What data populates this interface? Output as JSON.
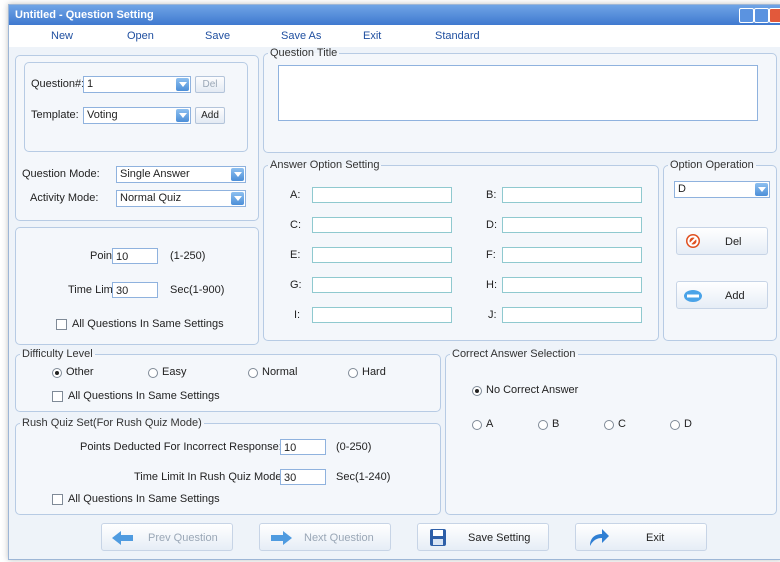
{
  "window": {
    "title": "Untitled - Question Setting"
  },
  "menu": [
    "New",
    "Open",
    "Save",
    "Save As",
    "Exit",
    "Standard"
  ],
  "question": {
    "number_label": "Question#:",
    "number_value": "1",
    "del_label": "Del",
    "template_label": "Template:",
    "template_value": "Voting",
    "add_label": "Add"
  },
  "modes": {
    "question_mode_label": "Question Mode:",
    "question_mode_value": "Single Answer",
    "activity_mode_label": "Activity Mode:",
    "activity_mode_value": "Normal Quiz"
  },
  "points": {
    "point_label": "Point:",
    "point_value": "10",
    "point_range": "(1-250)",
    "time_label": "Time Limit:",
    "time_value": "30",
    "time_range": "Sec(1-900)",
    "same_settings": "All Questions In Same Settings"
  },
  "question_title": {
    "legend": "Question Title",
    "value": ""
  },
  "answer_options": {
    "legend": "Answer Option Setting",
    "options": [
      {
        "label": "A:",
        "value": ""
      },
      {
        "label": "B:",
        "value": ""
      },
      {
        "label": "C:",
        "value": ""
      },
      {
        "label": "D:",
        "value": ""
      },
      {
        "label": "E:",
        "value": ""
      },
      {
        "label": "F:",
        "value": ""
      },
      {
        "label": "G:",
        "value": ""
      },
      {
        "label": "H:",
        "value": ""
      },
      {
        "label": "I:",
        "value": ""
      },
      {
        "label": "J:",
        "value": ""
      }
    ]
  },
  "option_operation": {
    "legend": "Option Operation",
    "selected": "D",
    "del_label": "Del",
    "add_label": "Add"
  },
  "difficulty": {
    "legend": "Difficulty Level",
    "options": [
      "Other",
      "Easy",
      "Normal",
      "Hard"
    ],
    "selected": "Other",
    "same_settings": "All Questions In Same Settings"
  },
  "rush_quiz": {
    "legend": "Rush Quiz Set(For Rush Quiz Mode)",
    "deduct_label": "Points Deducted For Incorrect Response:",
    "deduct_value": "10",
    "deduct_range": "(0-250)",
    "time_label": "Time Limit In Rush Quiz Mode:",
    "time_value": "30",
    "time_range": "Sec(1-240)",
    "same_settings": "All Questions In Same Settings"
  },
  "correct_answer": {
    "legend": "Correct Answer Selection",
    "no_correct": "No Correct Answer",
    "choices": [
      "A",
      "B",
      "C",
      "D"
    ]
  },
  "bottom": {
    "prev": "Prev Question",
    "next": "Next Question",
    "save": "Save Setting",
    "exit": "Exit"
  }
}
